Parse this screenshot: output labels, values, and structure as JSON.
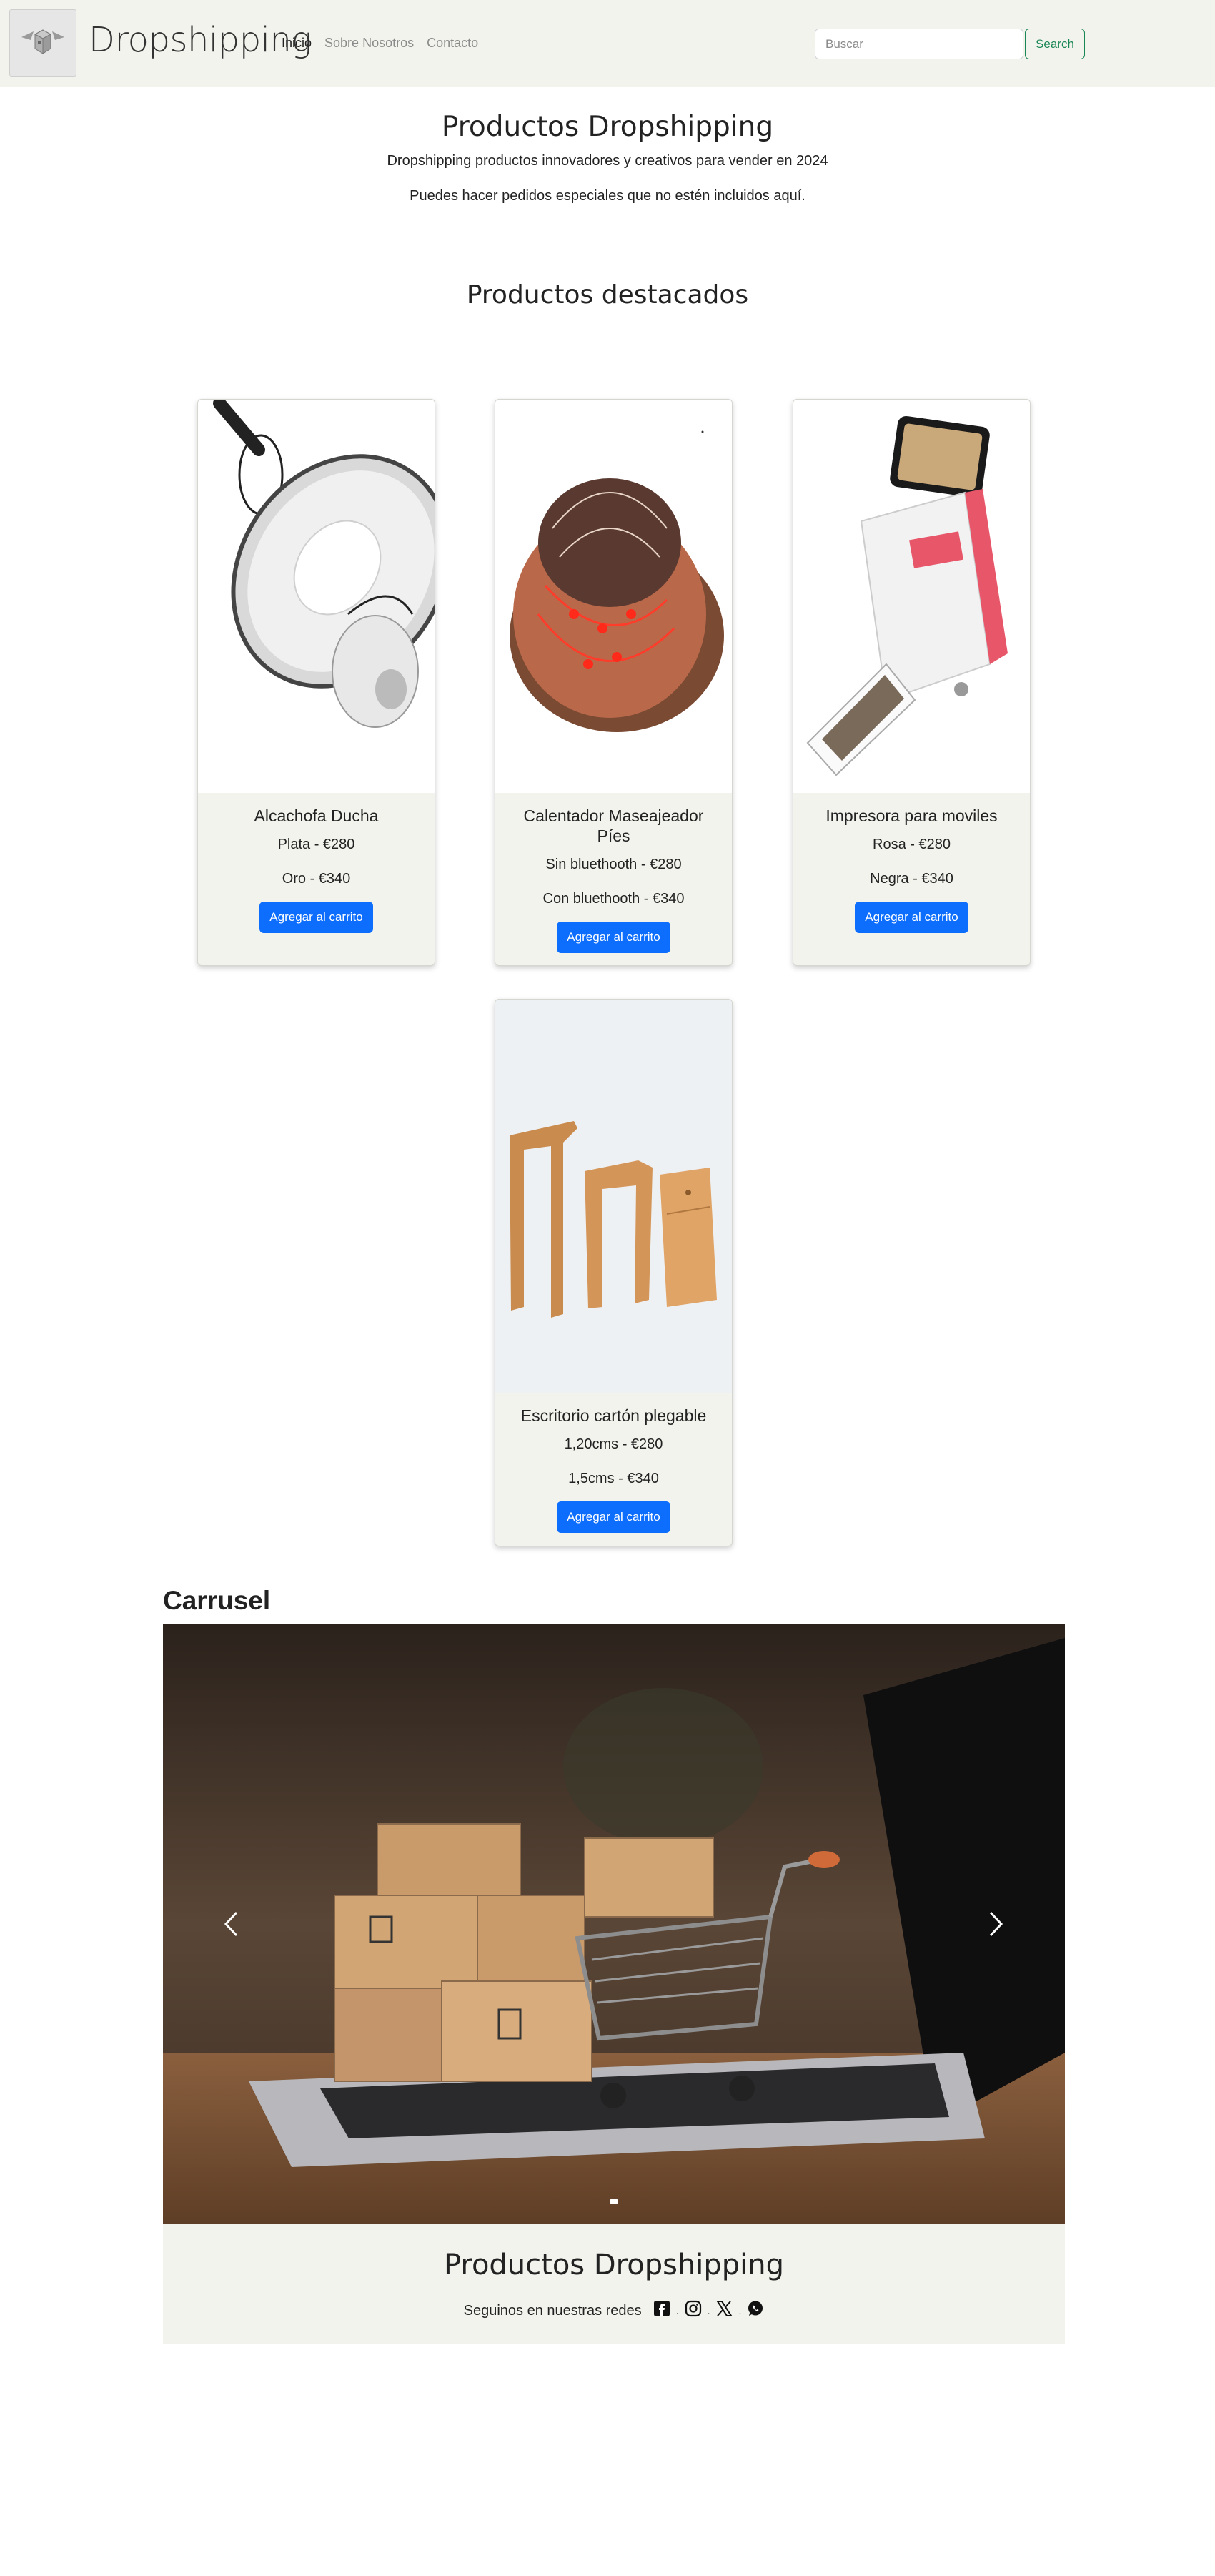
{
  "navbar": {
    "brand": "Dropshipping",
    "links": [
      "Inicio",
      "Sobre Nosotros",
      "Contacto"
    ],
    "search_placeholder": "Buscar",
    "search_label": "Search"
  },
  "hero": {
    "title": "Productos Dropshipping",
    "subtitle": "Dropshipping productos innovadores y creativos para vender en 2024",
    "note": "Puedes hacer pedidos especiales que no estén incluidos aquí."
  },
  "featured": {
    "title": "Productos destacados",
    "button_label": "Agregar al carrito",
    "products": [
      {
        "name": "Alcachofa Ducha",
        "options": [
          "Plata - €280",
          "Oro - €340"
        ]
      },
      {
        "name": "Calentador Maseajeador Píes",
        "options": [
          "Sin bluethooth - €280",
          "Con bluethooth - €340"
        ]
      },
      {
        "name": "Impresora para moviles",
        "options": [
          "Rosa - €280",
          "Negra - €340"
        ]
      },
      {
        "name": "Escritorio cartón plegable",
        "options": [
          "1,20cms - €280",
          "1,5cms - €340"
        ]
      }
    ]
  },
  "carousel": {
    "title": "Carrusel"
  },
  "footer": {
    "title": "Productos Dropshipping",
    "social_text": "Seguinos en nuestras redes",
    "separators": [
      ".",
      ".",
      "."
    ]
  },
  "colors": {
    "navbar_bg": "#f3f3ee",
    "primary": "#0d6efd",
    "search_outline": "#198754"
  }
}
